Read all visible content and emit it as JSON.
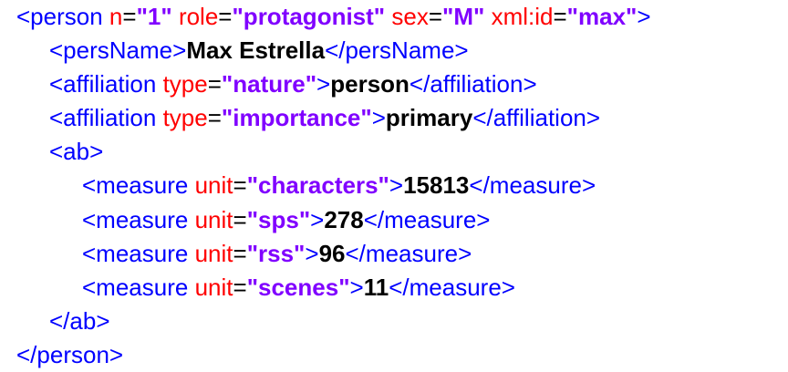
{
  "colors": {
    "tag": "#0000ff",
    "attribute": "#ff0000",
    "value": "#8000ff",
    "text": "#000000"
  },
  "lines": [
    {
      "indent": 0,
      "tokens": [
        {
          "t": "tag",
          "v": "<person"
        },
        {
          "t": "sp"
        },
        {
          "t": "attr",
          "v": "n"
        },
        {
          "t": "eq",
          "v": "="
        },
        {
          "t": "val",
          "v": "\"1\""
        },
        {
          "t": "sp"
        },
        {
          "t": "attr",
          "v": "role"
        },
        {
          "t": "eq",
          "v": "="
        },
        {
          "t": "val",
          "v": "\"protagonist\""
        },
        {
          "t": "sp"
        },
        {
          "t": "attr",
          "v": "sex"
        },
        {
          "t": "eq",
          "v": "="
        },
        {
          "t": "val",
          "v": "\"M\""
        },
        {
          "t": "sp"
        },
        {
          "t": "attr",
          "v": "xml:id"
        },
        {
          "t": "eq",
          "v": "="
        },
        {
          "t": "val",
          "v": "\"max\""
        },
        {
          "t": "tag",
          "v": ">"
        }
      ]
    },
    {
      "indent": 1,
      "tokens": [
        {
          "t": "tag",
          "v": "<persName>"
        },
        {
          "t": "text",
          "v": "Max Estrella"
        },
        {
          "t": "tag",
          "v": "</persName>"
        }
      ]
    },
    {
      "indent": 1,
      "tokens": [
        {
          "t": "tag",
          "v": "<affiliation"
        },
        {
          "t": "sp"
        },
        {
          "t": "attr",
          "v": "type"
        },
        {
          "t": "eq",
          "v": "="
        },
        {
          "t": "val",
          "v": "\"nature\""
        },
        {
          "t": "tag",
          "v": ">"
        },
        {
          "t": "text",
          "v": "person"
        },
        {
          "t": "tag",
          "v": "</affiliation>"
        }
      ]
    },
    {
      "indent": 1,
      "tokens": [
        {
          "t": "tag",
          "v": "<affiliation"
        },
        {
          "t": "sp"
        },
        {
          "t": "attr",
          "v": "type"
        },
        {
          "t": "eq",
          "v": "="
        },
        {
          "t": "val",
          "v": "\"importance\""
        },
        {
          "t": "tag",
          "v": ">"
        },
        {
          "t": "text",
          "v": "primary"
        },
        {
          "t": "tag",
          "v": "</affiliation>"
        }
      ]
    },
    {
      "indent": 1,
      "tokens": [
        {
          "t": "tag",
          "v": "<ab>"
        }
      ]
    },
    {
      "indent": 2,
      "tokens": [
        {
          "t": "tag",
          "v": "<measure"
        },
        {
          "t": "sp"
        },
        {
          "t": "attr",
          "v": "unit"
        },
        {
          "t": "eq",
          "v": "="
        },
        {
          "t": "val",
          "v": "\"characters\""
        },
        {
          "t": "tag",
          "v": ">"
        },
        {
          "t": "text",
          "v": "15813"
        },
        {
          "t": "tag",
          "v": "</measure>"
        }
      ]
    },
    {
      "indent": 2,
      "tokens": [
        {
          "t": "tag",
          "v": "<measure"
        },
        {
          "t": "sp"
        },
        {
          "t": "attr",
          "v": "unit"
        },
        {
          "t": "eq",
          "v": "="
        },
        {
          "t": "val",
          "v": "\"sps\""
        },
        {
          "t": "tag",
          "v": ">"
        },
        {
          "t": "text",
          "v": "278"
        },
        {
          "t": "tag",
          "v": "</measure>"
        }
      ]
    },
    {
      "indent": 2,
      "tokens": [
        {
          "t": "tag",
          "v": "<measure"
        },
        {
          "t": "sp"
        },
        {
          "t": "attr",
          "v": "unit"
        },
        {
          "t": "eq",
          "v": "="
        },
        {
          "t": "val",
          "v": "\"rss\""
        },
        {
          "t": "tag",
          "v": ">"
        },
        {
          "t": "text",
          "v": "96"
        },
        {
          "t": "tag",
          "v": "</measure>"
        }
      ]
    },
    {
      "indent": 2,
      "tokens": [
        {
          "t": "tag",
          "v": "<measure"
        },
        {
          "t": "sp"
        },
        {
          "t": "attr",
          "v": "unit"
        },
        {
          "t": "eq",
          "v": "="
        },
        {
          "t": "val",
          "v": "\"scenes\""
        },
        {
          "t": "tag",
          "v": ">"
        },
        {
          "t": "text",
          "v": "11"
        },
        {
          "t": "tag",
          "v": "</measure>"
        }
      ]
    },
    {
      "indent": 1,
      "tokens": [
        {
          "t": "tag",
          "v": "</ab>"
        }
      ]
    },
    {
      "indent": 0,
      "tokens": [
        {
          "t": "tag",
          "v": "</person>"
        }
      ]
    }
  ]
}
